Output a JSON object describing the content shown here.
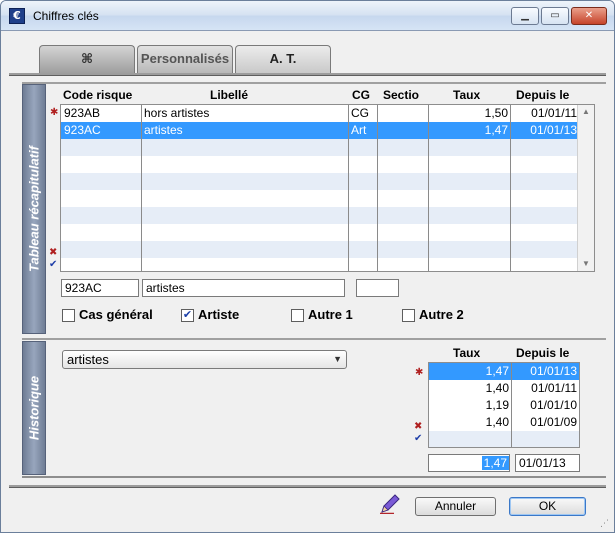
{
  "window": {
    "title": "Chiffres clés",
    "app_icon_glyph": "€",
    "min_glyph": "▁",
    "max_glyph": "▭",
    "close_glyph": "✕"
  },
  "tabs": [
    {
      "label": "⌘",
      "icon": "tool-icon"
    },
    {
      "label": "Personnalisés"
    },
    {
      "label": "A. T.",
      "active": true
    }
  ],
  "summary": {
    "section_label": "Tableau récapitulatif",
    "columns": [
      "Code risque",
      "Libellé",
      "CG",
      "Sectio",
      "Taux",
      "Depuis le"
    ],
    "rows": [
      {
        "code": "923AB",
        "libelle": "hors artistes",
        "cg": "CG",
        "section": "",
        "taux": "1,50",
        "depuis": "01/01/11"
      },
      {
        "code": "923AC",
        "libelle": "artistes",
        "cg": "Art",
        "section": "",
        "taux": "1,47",
        "depuis": "01/01/13",
        "selected": true
      }
    ],
    "edit": {
      "code": "923AC",
      "libelle": "artistes",
      "section": ""
    },
    "checkboxes": [
      {
        "label": "Cas général",
        "checked": false
      },
      {
        "label": "Artiste",
        "checked": true
      },
      {
        "label": "Autre 1",
        "checked": false
      },
      {
        "label": "Autre 2",
        "checked": false
      }
    ]
  },
  "history": {
    "section_label": "Historique",
    "dropdown_value": "artistes",
    "columns": [
      "Taux",
      "Depuis le"
    ],
    "rows": [
      {
        "taux": "1,47",
        "depuis": "01/01/13",
        "selected": true
      },
      {
        "taux": "1,40",
        "depuis": "01/01/11"
      },
      {
        "taux": "1,19",
        "depuis": "01/01/10"
      },
      {
        "taux": "1,40",
        "depuis": "01/01/09"
      }
    ],
    "edit": {
      "taux": "1,47",
      "depuis": "01/01/13"
    }
  },
  "footer": {
    "cancel_label": "Annuler",
    "ok_label": "OK"
  },
  "glyphs": {
    "star": "✱",
    "cross": "✖",
    "check": "✔",
    "up": "▲",
    "down": "▼",
    "dropdown_arrow": "▼",
    "grip": "⋰"
  },
  "colors": {
    "selection": "#3399ff",
    "alt_row": "#e6edf7",
    "side_strip": "#7f8ca4"
  }
}
